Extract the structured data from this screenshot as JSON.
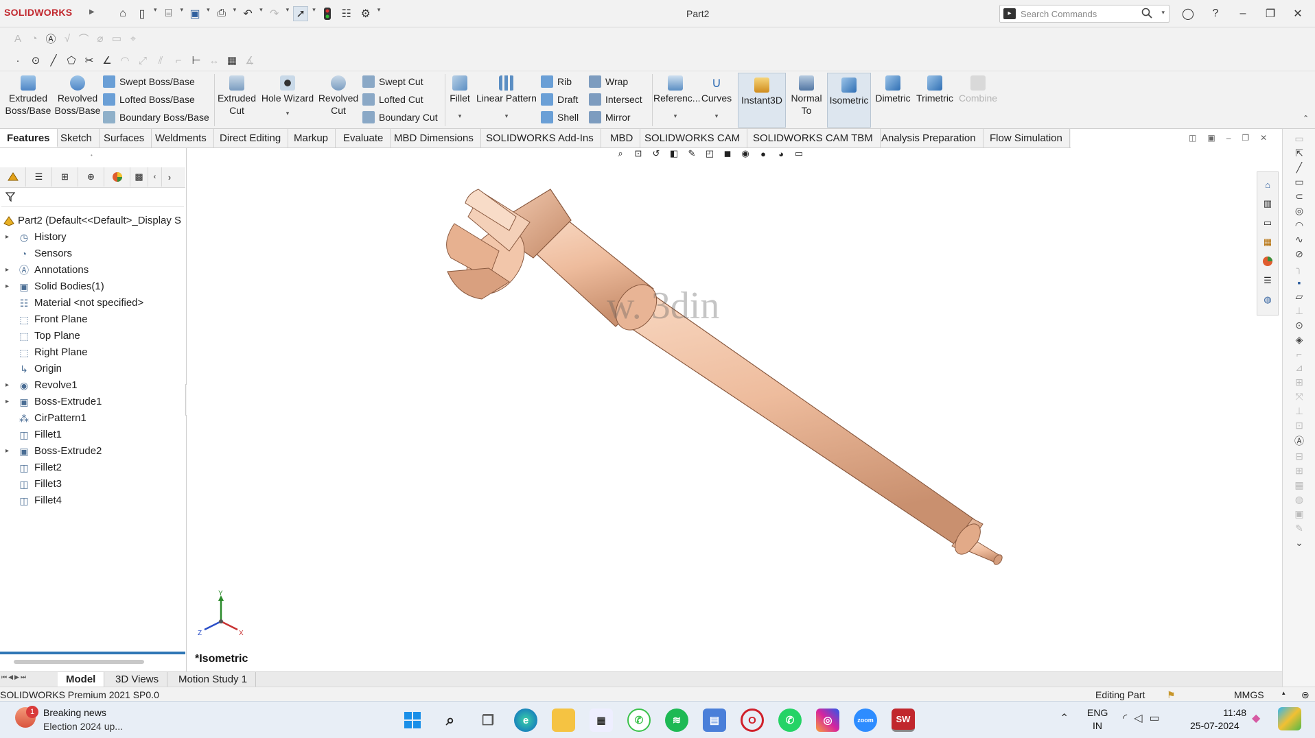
{
  "app": {
    "logo": "SOLIDWORKS",
    "title": "Part2"
  },
  "search": {
    "placeholder": "Search Commands"
  },
  "ribbon": {
    "extruded_boss": "Extruded Boss/Base",
    "revolved_boss": "Revolved Boss/Base",
    "swept_boss": "Swept Boss/Base",
    "lofted_boss": "Lofted Boss/Base",
    "boundary_boss": "Boundary Boss/Base",
    "extruded_cut": "Extruded Cut",
    "hole_wizard": "Hole Wizard",
    "revolved_cut": "Revolved Cut",
    "swept_cut": "Swept Cut",
    "lofted_cut": "Lofted Cut",
    "boundary_cut": "Boundary Cut",
    "fillet": "Fillet",
    "linear_pattern": "Linear Pattern",
    "rib": "Rib",
    "draft": "Draft",
    "shell": "Shell",
    "wrap": "Wrap",
    "intersect": "Intersect",
    "mirror": "Mirror",
    "reference": "Referenc...",
    "curves": "Curves",
    "instant3d": "Instant3D",
    "normal_to": "Normal To",
    "isometric": "Isometric",
    "dimetric": "Dimetric",
    "trimetric": "Trimetric",
    "combine": "Combine"
  },
  "tabs": [
    "Features",
    "Sketch",
    "Surfaces",
    "Weldments",
    "Direct Editing",
    "Markup",
    "Evaluate",
    "MBD Dimensions",
    "SOLIDWORKS Add-Ins",
    "MBD",
    "SOLIDWORKS CAM",
    "SOLIDWORKS CAM TBM",
    "Analysis Preparation",
    "Flow Simulation"
  ],
  "tree": {
    "root": "Part2  (Default<<Default>_Display S",
    "items": [
      {
        "label": "History",
        "expandable": true
      },
      {
        "label": "Sensors",
        "expandable": false
      },
      {
        "label": "Annotations",
        "expandable": true
      },
      {
        "label": "Solid Bodies(1)",
        "expandable": true
      },
      {
        "label": "Material <not specified>",
        "expandable": false
      },
      {
        "label": "Front Plane",
        "expandable": false
      },
      {
        "label": "Top Plane",
        "expandable": false
      },
      {
        "label": "Right Plane",
        "expandable": false
      },
      {
        "label": "Origin",
        "expandable": false
      },
      {
        "label": "Revolve1",
        "expandable": true
      },
      {
        "label": "Boss-Extrude1",
        "expandable": true
      },
      {
        "label": "CirPattern1",
        "expandable": false
      },
      {
        "label": "Fillet1",
        "expandable": false
      },
      {
        "label": "Boss-Extrude2",
        "expandable": true
      },
      {
        "label": "Fillet2",
        "expandable": false
      },
      {
        "label": "Fillet3",
        "expandable": false
      },
      {
        "label": "Fillet4",
        "expandable": false
      }
    ]
  },
  "viewport": {
    "view_label": "*Isometric",
    "watermark": "w. 3din",
    "triad": {
      "x": "X",
      "y": "Y",
      "z": "Z"
    }
  },
  "bottom_tabs": [
    "Model",
    "3D Views",
    "Motion Study 1"
  ],
  "status": {
    "version": "SOLIDWORKS Premium 2021 SP0.0",
    "mode": "Editing Part",
    "units": "MMGS"
  },
  "taskbar": {
    "news_title": "Breaking news",
    "news_sub": "Election 2024 up...",
    "news_badge": "1",
    "lang": "ENG",
    "region": "IN",
    "time": "11:48",
    "date": "25-07-2024"
  },
  "colors": {
    "part": "#f2c2a4",
    "accent": "#2f76b5",
    "logo": "#c1272d"
  }
}
